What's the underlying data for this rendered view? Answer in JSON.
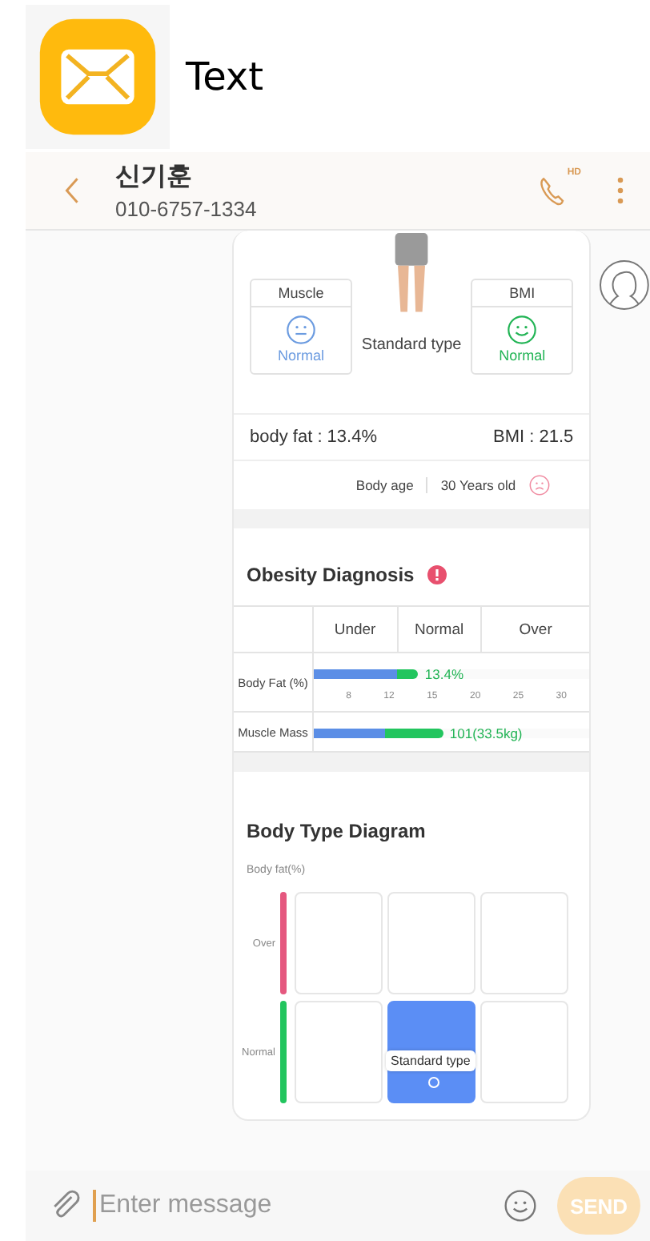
{
  "app": {
    "label": "Text"
  },
  "conversation": {
    "name": "신기훈",
    "number": "010-6757-1334",
    "call_badge": "HD"
  },
  "report": {
    "indicators": [
      {
        "label": "Muscle",
        "status": "Normal",
        "kind": "neutral",
        "color": "#6b9be0"
      },
      {
        "label": "BMI",
        "status": "Normal",
        "kind": "smile",
        "color": "#22b455"
      }
    ],
    "figure_label": "Standard type",
    "body_fat": "body fat : 13.4%",
    "bmi": "BMI : 21.5",
    "body_age": {
      "label": "Body age",
      "value": "30 Years old",
      "kind": "sad",
      "color": "#f08aa0"
    },
    "obesity": {
      "title": "Obesity Diagnosis",
      "columns": [
        "Under",
        "Normal",
        "Over"
      ],
      "rows": [
        {
          "label": "Body Fat (%)",
          "level": 0.38,
          "reading": "13.4%",
          "ticks": [
            "8",
            "12",
            "15",
            "20",
            "25",
            "30"
          ]
        },
        {
          "label": "Muscle Mass",
          "level": 0.47,
          "reading": "101(33.5kg)"
        }
      ]
    },
    "body_type": {
      "title": "Body Type Diagram",
      "axis_label": "Body fat(%)",
      "tooltip": "Standard type",
      "rows": [
        {
          "label": "Over",
          "color": "#e5587f",
          "cells": [
            {
              "selected": false
            },
            {
              "selected": false
            },
            {
              "selected": false
            }
          ]
        },
        {
          "label": "Normal",
          "color": "#22c55e",
          "cells": [
            {
              "selected": false
            },
            {
              "selected": true
            },
            {
              "selected": false
            }
          ]
        }
      ]
    }
  },
  "composer": {
    "placeholder": "Enter message",
    "send": "SEND"
  }
}
